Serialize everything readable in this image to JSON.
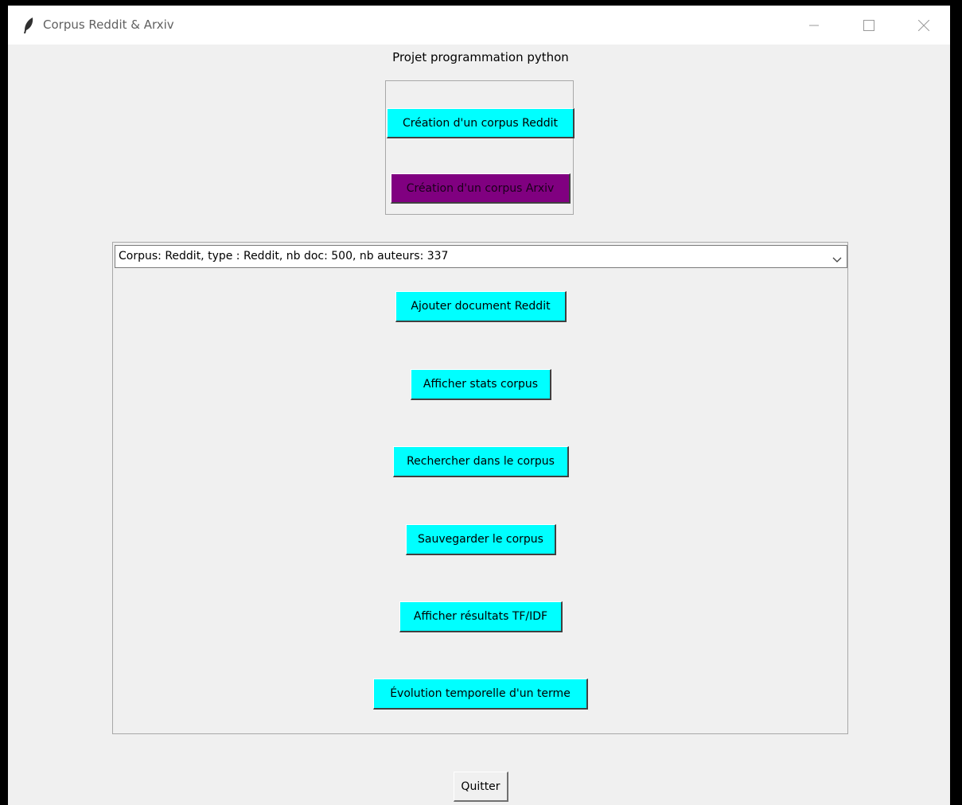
{
  "window": {
    "title": "Corpus Reddit & Arxiv",
    "icon": "feather-icon",
    "controls": [
      "minimize-icon",
      "maximize-icon",
      "close-icon"
    ]
  },
  "header": {
    "title": "Projet programmation python"
  },
  "create": {
    "reddit_label": "Création d'un corpus Reddit",
    "arxiv_label": "Création d'un corpus Arxiv"
  },
  "corpus": {
    "selected": "Corpus: Reddit, type : Reddit, nb doc: 500, nb auteurs: 337",
    "actions": {
      "add_doc": "Ajouter document Reddit",
      "stats": "Afficher stats corpus",
      "search": "Rechercher dans le corpus",
      "save": "Sauvegarder le corpus",
      "tfidf": "Afficher résultats TF/IDF",
      "evolution": "Évolution temporelle d'un terme"
    }
  },
  "footer": {
    "quit_label": "Quitter"
  },
  "colors": {
    "accent_cyan": "#00ffff",
    "accent_purple": "#800080",
    "window_bg": "#f0f0f0"
  }
}
